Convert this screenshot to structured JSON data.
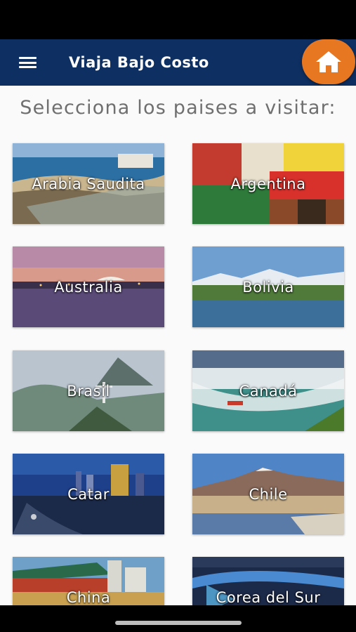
{
  "app_bar": {
    "title": "Viaja Bajo Costo",
    "menu_icon": "hamburger-menu-icon",
    "home_icon": "home-icon",
    "bar_color": "#0d2f61",
    "home_button_color": "#e87722"
  },
  "main": {
    "heading": "Selecciona los paises a visitar:",
    "countries": [
      {
        "label": "Arabia Saudita"
      },
      {
        "label": "Argentina"
      },
      {
        "label": "Australia"
      },
      {
        "label": "Bolivia"
      },
      {
        "label": "Brasil"
      },
      {
        "label": "Canadá"
      },
      {
        "label": "Catar"
      },
      {
        "label": "Chile"
      },
      {
        "label": "China"
      },
      {
        "label": "Corea del Sur"
      }
    ]
  }
}
